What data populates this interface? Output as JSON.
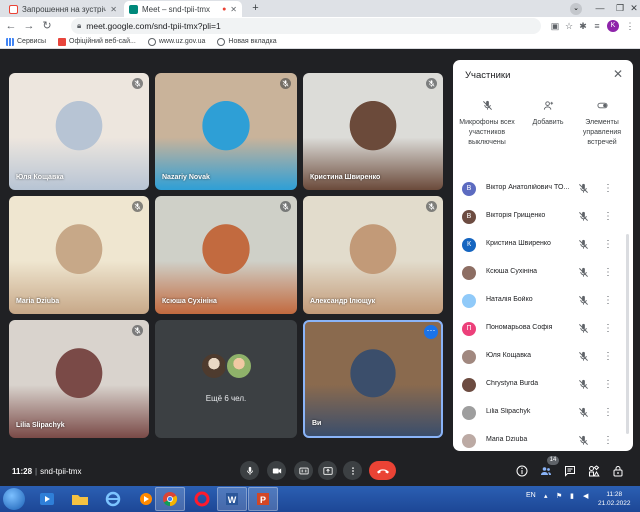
{
  "browser": {
    "tabs": [
      {
        "title": "Запрошення на зустріч: Калин",
        "favicon_color": "#ea4335",
        "active": false
      },
      {
        "title": "Meet – snd-tpii-tmx",
        "favicon_color": "#00897b",
        "active": true
      }
    ],
    "url": "meet.google.com/snd-tpii-tmx?pli=1",
    "profile_letter": "K",
    "bookmarks": [
      {
        "label": "Сервисы",
        "icon": "apps-icon"
      },
      {
        "label": "Офіційний веб-сай...",
        "icon": "web-icon"
      },
      {
        "label": "www.uz.gov.ua",
        "icon": "globe-icon"
      },
      {
        "label": "Новая вкладка",
        "icon": "globe-icon"
      }
    ]
  },
  "tiles": [
    {
      "name": "Юля Кощавка",
      "muted": true,
      "colors": [
        "#ede6de",
        "#b7c4d4"
      ]
    },
    {
      "name": "Nazariy Novak",
      "muted": true,
      "colors": [
        "#c9b39a",
        "#2e9fd6"
      ]
    },
    {
      "name": "Кристина Швиренко",
      "muted": true,
      "colors": [
        "#dcdcd8",
        "#6b4a3a"
      ]
    },
    {
      "name": "Maria Dziuba",
      "muted": true,
      "colors": [
        "#efe6d0",
        "#c7a888"
      ]
    },
    {
      "name": "Ксюша Сухініна",
      "muted": true,
      "colors": [
        "#cfd0c8",
        "#c26a3f"
      ]
    },
    {
      "name": "Александр Ілющук",
      "muted": true,
      "colors": [
        "#e2dccc",
        "#c29a78"
      ]
    },
    {
      "name": "Lilia Slipachyk",
      "muted": true,
      "colors": [
        "#d9d3cd",
        "#7a4a47"
      ]
    },
    {
      "name": "Ви",
      "muted": false,
      "self": true,
      "colors": [
        "#8a6a4e",
        "#3b4e6b"
      ]
    }
  ],
  "more_tile": {
    "label": "Ещё 6 чел."
  },
  "meeting": {
    "time": "11:28",
    "code": "snd-tpii-tmx"
  },
  "controls": {
    "participants_count": "14"
  },
  "panel": {
    "title": "Участники",
    "actions": [
      {
        "label": "Микрофоны всех участников выключены",
        "icon": "mic-off-icon"
      },
      {
        "label": "Добавить",
        "icon": "add-person-icon"
      },
      {
        "label": "Элементы управления встречей",
        "icon": "toggle-icon"
      }
    ],
    "participants": [
      {
        "name": "Віктор Анатолійович ТО...",
        "letter": "В",
        "color": "#5c6bc0"
      },
      {
        "name": "Вікторія Грищенко",
        "letter": "В",
        "color": "#6d4c41"
      },
      {
        "name": "Кристина Швиренко",
        "letter": "К",
        "color": "#1565c0"
      },
      {
        "name": "Ксюша Сухініна",
        "letter": "",
        "color": "#8d6e63"
      },
      {
        "name": "Наталія Бойко",
        "letter": "",
        "color": "#90caf9"
      },
      {
        "name": "Пономарьова Софія",
        "letter": "П",
        "color": "#ec407a"
      },
      {
        "name": "Юля Кощавка",
        "letter": "",
        "color": "#a1887f"
      },
      {
        "name": "Chrystyna Burda",
        "letter": "",
        "color": "#6d4c41"
      },
      {
        "name": "Lilia Slipachyk",
        "letter": "",
        "color": "#9e9e9e"
      },
      {
        "name": "Maria Dziuba",
        "letter": "",
        "color": "#bcaaa4"
      }
    ]
  },
  "taskbar": {
    "lang": "EN",
    "time": "11:28",
    "date": "21.02.2022"
  }
}
